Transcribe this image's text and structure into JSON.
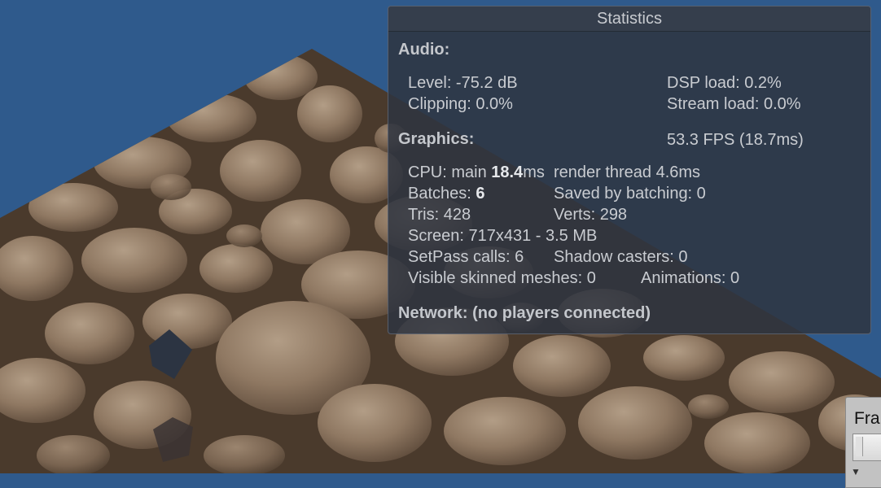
{
  "statistics": {
    "title": "Statistics",
    "audio": {
      "heading": "Audio:",
      "level": "Level: -75.2 dB",
      "clipping": "Clipping: 0.0%",
      "dsp_load": "DSP load: 0.2%",
      "stream_load": "Stream load: 0.0%"
    },
    "graphics": {
      "heading": "Graphics:",
      "fps": "53.3 FPS (18.7ms)",
      "cpu_prefix": "CPU: main ",
      "cpu_main_value": "18.4",
      "cpu_suffix": "ms  render thread 4.6ms",
      "batches_prefix": "Batches: ",
      "batches_value": "6",
      "saved_by_batching": "Saved by batching: 0",
      "tris": "Tris: 428",
      "verts": "Verts: 298",
      "screen": "Screen: 717x431 - 3.5 MB",
      "setpass": "SetPass calls: 6",
      "shadow_casters": "Shadow casters: 0",
      "visible_skinned": "Visible skinned meshes: 0",
      "animations": "Animations: 0"
    },
    "network": "Network: (no players connected)"
  },
  "frame_panel": {
    "label": "Fra"
  },
  "colors": {
    "background": "#2f5a8c",
    "panel": "#2e3440",
    "text": "#c9ccd1"
  }
}
